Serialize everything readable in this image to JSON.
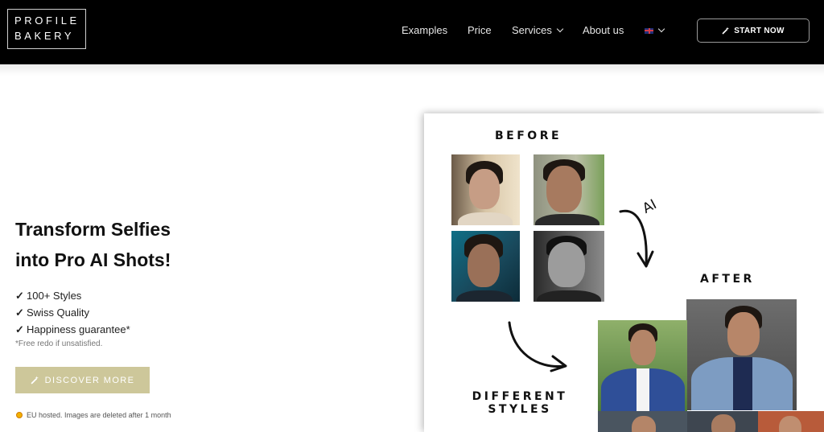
{
  "brand": {
    "line1": "PROFILE",
    "line2": "BAKERY"
  },
  "nav": {
    "examples": "Examples",
    "price": "Price",
    "services": "Services",
    "about": "About us",
    "start_now": "START NOW"
  },
  "hero": {
    "title_line1": "Transform Selfies",
    "title_line2": "into Pro AI Shots!",
    "features": [
      "100+ Styles",
      "Swiss Quality",
      "Happiness guarantee*"
    ],
    "check_mark": "✓",
    "note": "*Free redo if unsatisfied.",
    "discover_label": "DISCOVER MORE",
    "eu_note": "EU hosted. Images are deleted after 1 month"
  },
  "showcase": {
    "before_label": "BEFORE",
    "after_label": "AFTER",
    "ai_label": "AI",
    "different_line1": "DIFFERENT",
    "different_line2": "STYLES"
  },
  "icons": {
    "services_dropdown": "chevron-down-icon",
    "language": "uk-flag-icon",
    "start_now": "magic-wand-icon",
    "discover": "magic-wand-icon",
    "eu": "eu-star-icon"
  },
  "colors": {
    "header_bg": "#000000",
    "accent_button": "#cdc79a",
    "text_dark": "#111111"
  }
}
